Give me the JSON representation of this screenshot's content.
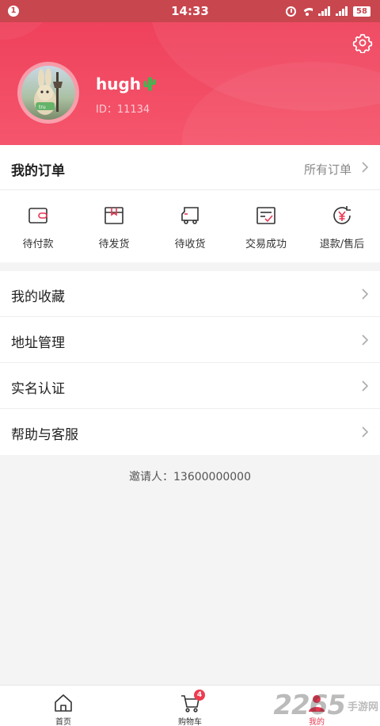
{
  "status_bar": {
    "notification_count": "1",
    "time": "14:33",
    "battery": "58",
    "icons": [
      "alarm-icon",
      "wifi-icon",
      "signal-icon",
      "signal-icon",
      "battery-icon"
    ]
  },
  "colors": {
    "accent": "#ee3d58",
    "status_bar": "#c8464e",
    "badge": "#ee3b50"
  },
  "profile": {
    "username": "hugh",
    "username_emoji": "🌵",
    "id_text": "ID：11134",
    "settings_icon": "gear-icon"
  },
  "orders": {
    "title": "我的订单",
    "all_label": "所有订单",
    "items": [
      {
        "label": "待付款",
        "icon": "wallet-icon"
      },
      {
        "label": "待发货",
        "icon": "package-icon"
      },
      {
        "label": "待收货",
        "icon": "truck-icon"
      },
      {
        "label": "交易成功",
        "icon": "checklist-icon"
      },
      {
        "label": "退款/售后",
        "icon": "refund-icon"
      }
    ]
  },
  "menu": {
    "items": [
      {
        "label": "我的收藏"
      },
      {
        "label": "地址管理"
      },
      {
        "label": "实名认证"
      },
      {
        "label": "帮助与客服"
      }
    ]
  },
  "inviter": "邀请人：13600000000",
  "bottom_nav": {
    "items": [
      {
        "label": "首页",
        "icon": "home-icon"
      },
      {
        "label": "购物车",
        "icon": "cart-icon",
        "badge": "4"
      },
      {
        "label": "我的",
        "icon": "user-icon",
        "active": true
      }
    ]
  },
  "watermark": {
    "text": "2265",
    "suffix": "手游网"
  }
}
